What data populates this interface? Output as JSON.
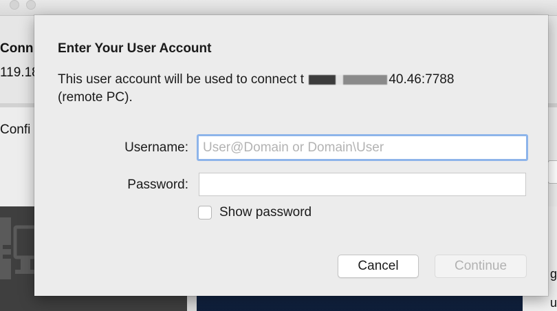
{
  "background_window": {
    "heading_fragment": "Conn",
    "ip_fragment": "119.18",
    "section_fragment": "Confi",
    "right_fragment_1": "c",
    "right_fragment_2": "g",
    "right_fragment_3": "ug"
  },
  "dialog": {
    "title": "Enter Your User Account",
    "description_prefix": "This user account will be used to connect t",
    "description_ip_suffix": "40.46:7788",
    "description_line2": "(remote PC).",
    "username_label": "Username:",
    "username_placeholder": "User@Domain or Domain\\User",
    "username_value": "",
    "password_label": "Password:",
    "password_value": "",
    "show_password_label": "Show password",
    "show_password_checked": false,
    "cancel_label": "Cancel",
    "continue_label": "Continue",
    "continue_enabled": false
  },
  "colors": {
    "focus_ring": "#8db4ea",
    "dialog_bg": "#ececec",
    "disabled_text": "#b2b2b2"
  }
}
